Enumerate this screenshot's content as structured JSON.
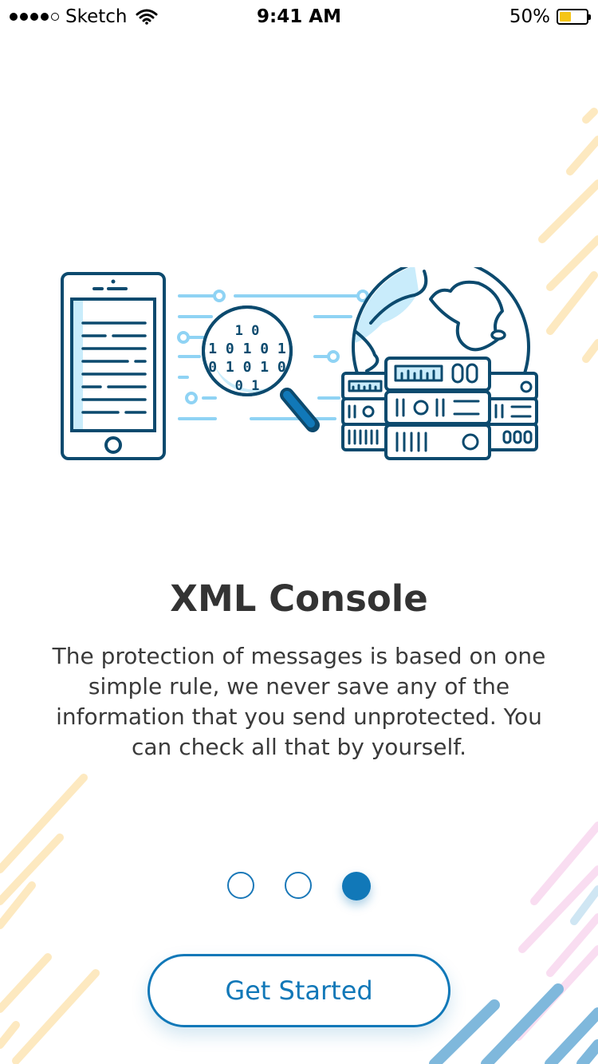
{
  "status_bar": {
    "carrier": "Sketch",
    "time": "9:41 AM",
    "battery_percent": "50%",
    "battery_level": 0.5,
    "signal_bars_filled": 4,
    "signal_bars_total": 5
  },
  "illustration": {
    "binary_lines": [
      "1 0",
      "1 0 1 0 1",
      "0 1 0 1 0",
      "0 1"
    ]
  },
  "onboarding": {
    "title": "XML Console",
    "description": "The protection of messages is based on one simple rule, we never save any of the information that you send unprotected. You can check all that by yourself.",
    "pages_total": 3,
    "active_page": 3
  },
  "cta": {
    "label": "Get Started"
  },
  "colors": {
    "accent": "#1178b8",
    "illustration_stroke": "#0c4a6e",
    "illustration_light": "#8fd3f4",
    "deco_yellow": "#fde9c0",
    "deco_pink": "#f9ddf1",
    "deco_blue": "#7fb8dc",
    "battery": "#f5c518"
  }
}
